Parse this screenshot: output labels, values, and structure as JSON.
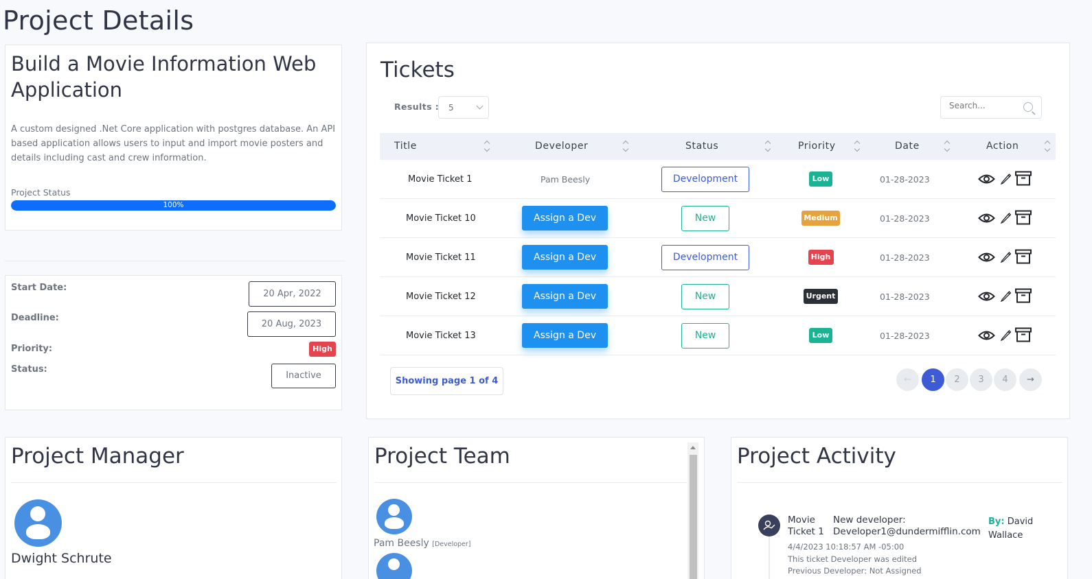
{
  "page": {
    "title": "Project Details"
  },
  "project": {
    "name": "Build a Movie Information Web Application",
    "description": "A custom designed .Net Core application with postgres database. An API based application allows users to input and import movie posters and details including cast and crew information.",
    "status_label": "Project Status",
    "progress_text": "100%",
    "progress_value": 100,
    "start_date_label": "Start Date:",
    "start_date": "20 Apr, 2022",
    "deadline_label": "Deadline:",
    "deadline": "20 Aug, 2023",
    "priority_label": "Priority:",
    "priority": "High",
    "status_field_label": "Status:",
    "status": "Inactive"
  },
  "tickets": {
    "title": "Tickets",
    "results_label": "Results :",
    "results_value": "5",
    "search_placeholder": "Search...",
    "columns": [
      "Title",
      "Developer",
      "Status",
      "Priority",
      "Date",
      "Action"
    ],
    "rows": [
      {
        "title": "Movie Ticket 1",
        "developer": "Pam Beesly",
        "status": "Development",
        "priority": "Low",
        "date": "01-28-2023"
      },
      {
        "title": "Movie Ticket 10",
        "developer": "Assign a Dev",
        "status": "New",
        "priority": "Medium",
        "date": "01-28-2023"
      },
      {
        "title": "Movie Ticket 11",
        "developer": "Assign a Dev",
        "status": "Development",
        "priority": "High",
        "date": "01-28-2023"
      },
      {
        "title": "Movie Ticket 12",
        "developer": "Assign a Dev",
        "status": "New",
        "priority": "Urgent",
        "date": "01-28-2023"
      },
      {
        "title": "Movie Ticket 13",
        "developer": "Assign a Dev",
        "status": "New",
        "priority": "Low",
        "date": "01-28-2023"
      }
    ],
    "showing_text": "Showing page 1 of 4",
    "pages": [
      "1",
      "2",
      "3",
      "4"
    ],
    "prev_glyph": "←",
    "next_glyph": "→"
  },
  "manager": {
    "title": "Project Manager",
    "name": "Dwight Schrute"
  },
  "team": {
    "title": "Project Team",
    "members": [
      {
        "name": "Pam Beesly",
        "role": "[Developer]"
      }
    ]
  },
  "activity": {
    "title": "Project Activity",
    "item": {
      "ticket": "Movie Ticket 1",
      "message": "New developer: Developer1@dundermifflin.com",
      "by_label": "By:",
      "by_name": "David Wallace",
      "timestamp": "4/4/2023 10:18:57 AM -05:00",
      "detail": "This ticket Developer was edited",
      "detail2": "Previous Developer: Not Assigned"
    }
  },
  "colors": {
    "accent": "#3d5bd4",
    "primary_button": "#1e90f0",
    "success": "#1ab394",
    "danger": "#e5434d",
    "warning": "#e6a23c",
    "dark": "#2b2f36"
  }
}
